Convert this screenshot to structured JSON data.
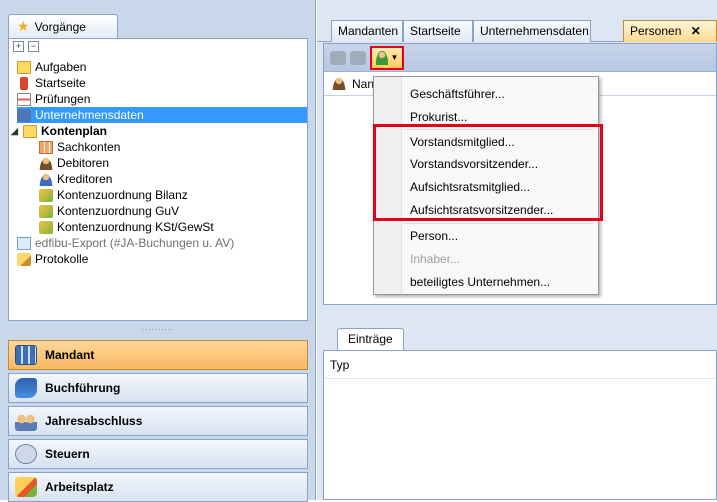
{
  "left": {
    "vorgaenge_tab": "Vorgänge",
    "tree": [
      {
        "label": "Aufgaben",
        "icon": "task-folder-icon"
      },
      {
        "label": "Startseite",
        "icon": "startpage-icon"
      },
      {
        "label": "Prüfungen",
        "icon": "report-icon"
      },
      {
        "label": "Unternehmensdaten",
        "icon": "company-data-icon",
        "selected": true
      },
      {
        "label": "Kontenplan",
        "icon": "folder-icon",
        "bold": true
      },
      {
        "label": "Sachkonten",
        "icon": "ledger-grid-icon"
      },
      {
        "label": "Debitoren",
        "icon": "debtor-person-icon"
      },
      {
        "label": "Kreditoren",
        "icon": "creditor-person-icon"
      },
      {
        "label": "Kontenzuordnung Bilanz",
        "icon": "assignment-cube-icon"
      },
      {
        "label": "Kontenzuordnung GuV",
        "icon": "assignment-cube-icon"
      },
      {
        "label": "Kontenzuordnung KSt/GewSt",
        "icon": "assignment-cube-icon"
      },
      {
        "label": "edfibu-Export (#JA-Buchungen u. AV)",
        "icon": "export-icon",
        "muted": true
      },
      {
        "label": "Protokolle",
        "icon": "pencil-icon"
      }
    ],
    "splitter": "..........",
    "nav": [
      {
        "label": "Mandant",
        "icon": "grid-icon",
        "active": true
      },
      {
        "label": "Buchführung",
        "icon": "book-icon"
      },
      {
        "label": "Jahresabschluss",
        "icon": "people-icon"
      },
      {
        "label": "Steuern",
        "icon": "s-icon"
      },
      {
        "label": "Arbeitsplatz",
        "icon": "pencil-icon"
      }
    ]
  },
  "right": {
    "tabs": [
      "Mandanten",
      "Startseite",
      "Unternehmensdaten",
      "Personen"
    ],
    "close_glyph": "✕",
    "persons_column": "Nan",
    "lower_tab": "Einträge",
    "lower_column": "Typ"
  },
  "menu": {
    "items": [
      {
        "label": "Geschäftsführer..."
      },
      {
        "label": "Prokurist..."
      },
      {
        "label": "Vorstandsmitglied..."
      },
      {
        "label": "Vorstandsvorsitzender..."
      },
      {
        "label": "Aufsichtsratsmitglied..."
      },
      {
        "label": "Aufsichtsratsvorsitzender..."
      },
      {
        "label": "Person..."
      },
      {
        "label": "Inhaber...",
        "disabled": true
      },
      {
        "label": "beteiligtes Unternehmen..."
      }
    ]
  },
  "colors": {
    "highlight": "#e3001b",
    "selection": "#3399ff",
    "accent": "#f6b861"
  }
}
